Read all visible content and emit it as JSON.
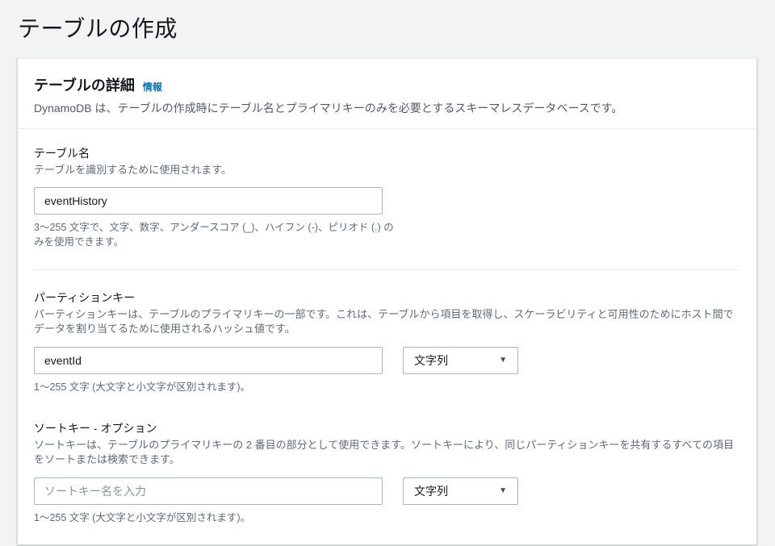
{
  "page": {
    "title": "テーブルの作成"
  },
  "panel": {
    "header": {
      "title": "テーブルの詳細",
      "info_link": "情報",
      "description": "DynamoDB は、テーブルの作成時にテーブル名とプライマリキーのみを必要とするスキーマレスデータベースです。"
    },
    "table_name": {
      "label": "テーブル名",
      "description": "テーブルを識別するために使用されます。",
      "value": "eventHistory",
      "constraint": "3〜255 文字で、文字、数字、アンダースコア (_)、ハイフン (-)、ピリオド (.) のみを使用できます。"
    },
    "partition_key": {
      "label": "パーティションキー",
      "description": "パーティションキーは、テーブルのプライマリキーの一部です。これは、テーブルから項目を取得し、スケーラビリティと可用性のためにホスト間でデータを割り当てるために使用されるハッシュ値です。",
      "value": "eventId",
      "type_selected": "文字列",
      "constraint": "1〜255 文字 (大文字と小文字が区別されます)。"
    },
    "sort_key": {
      "label": "ソートキー - オプション",
      "description": "ソートキーは、テーブルのプライマリキーの 2 番目の部分として使用できます。ソートキーにより、同じパーティションキーを共有するすべての項目をソートまたは検索できます。",
      "placeholder": "ソートキー名を入力",
      "type_selected": "文字列",
      "constraint": "1〜255 文字 (大文字と小文字が区別されます)。"
    }
  },
  "icons": {
    "dropdown_caret": "▼"
  },
  "colors": {
    "accent_link": "#0073bb",
    "page_background": "#f2f3f3",
    "panel_background": "#ffffff",
    "border": "#aab7b8",
    "divider": "#eaeded",
    "text_primary": "#16191f",
    "text_secondary": "#5f6b7a"
  }
}
